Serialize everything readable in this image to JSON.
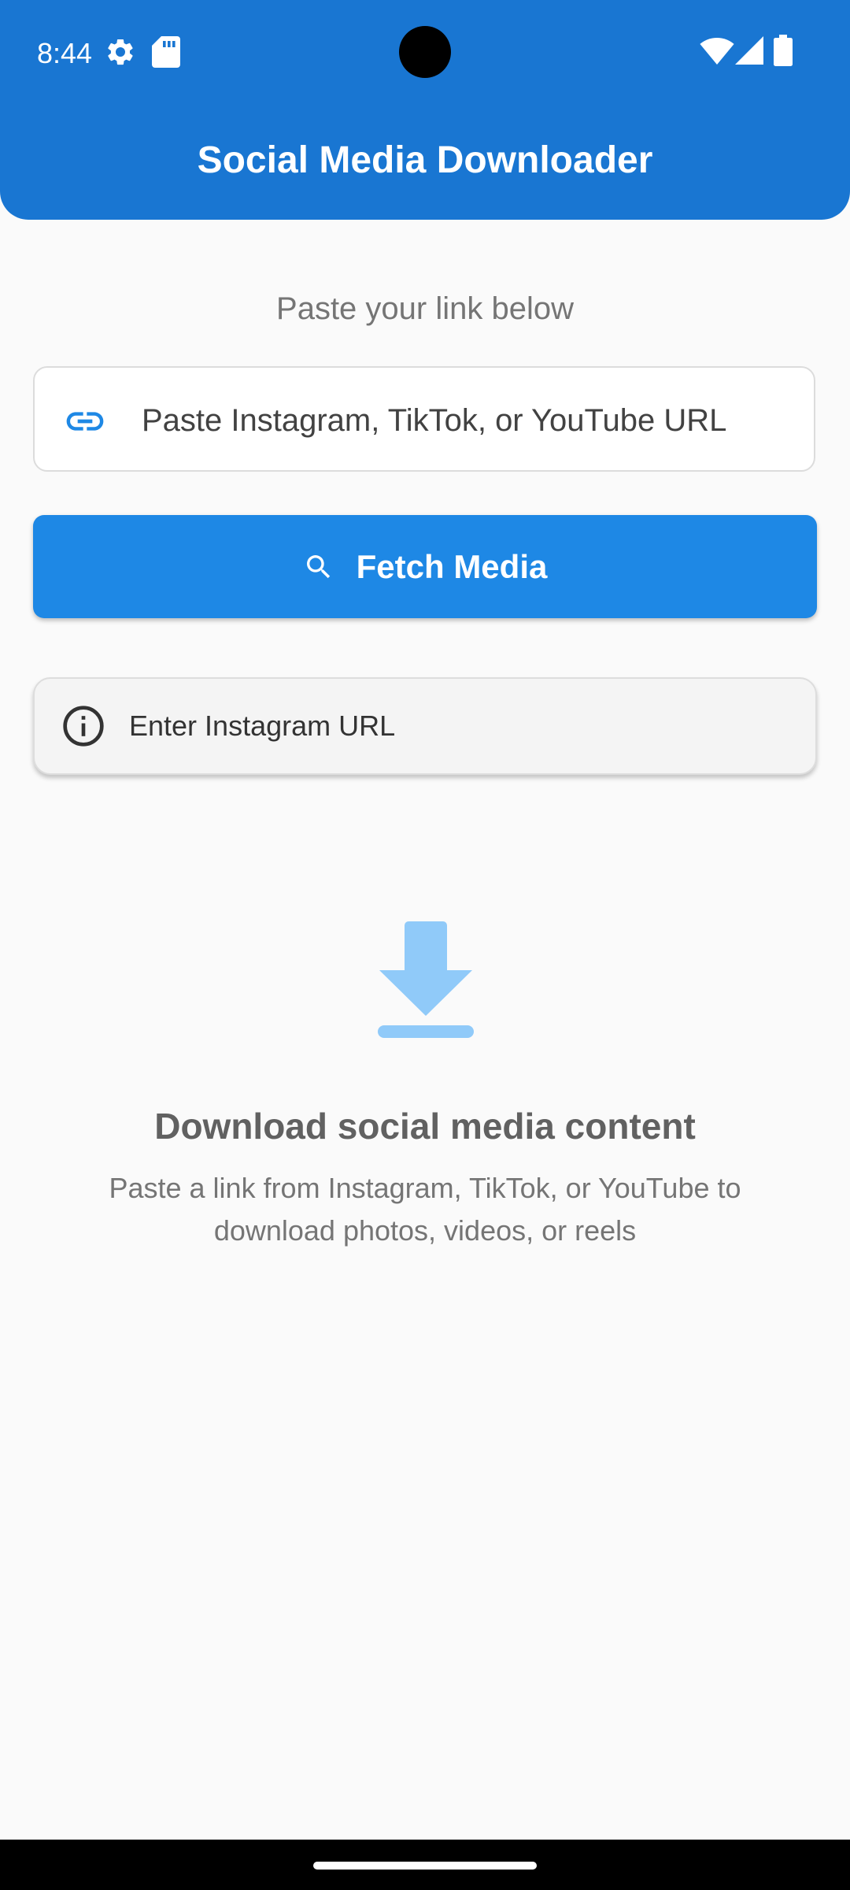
{
  "status_bar": {
    "time": "8:44",
    "icons": [
      "gear-icon",
      "sd-card-icon",
      "wifi-icon",
      "cell-signal-icon",
      "battery-icon"
    ]
  },
  "app_bar": {
    "title": "Social Media Downloader",
    "color": "#1976d2"
  },
  "main": {
    "prompt_label": "Paste your link below",
    "url_input": {
      "placeholder": "Paste Instagram, TikTok, or YouTube URL",
      "value": "",
      "icon": "link-icon"
    },
    "fetch_button": {
      "label": "Fetch Media",
      "icon": "search-icon",
      "color": "#1e88e5"
    },
    "info_card": {
      "icon": "info-icon",
      "text": "Enter Instagram URL"
    },
    "empty_state": {
      "icon": "download-icon",
      "icon_color": "#90caf9",
      "title": "Download social media content",
      "description": "Paste a link from Instagram, TikTok, or YouTube to download photos, videos, or reels"
    }
  }
}
